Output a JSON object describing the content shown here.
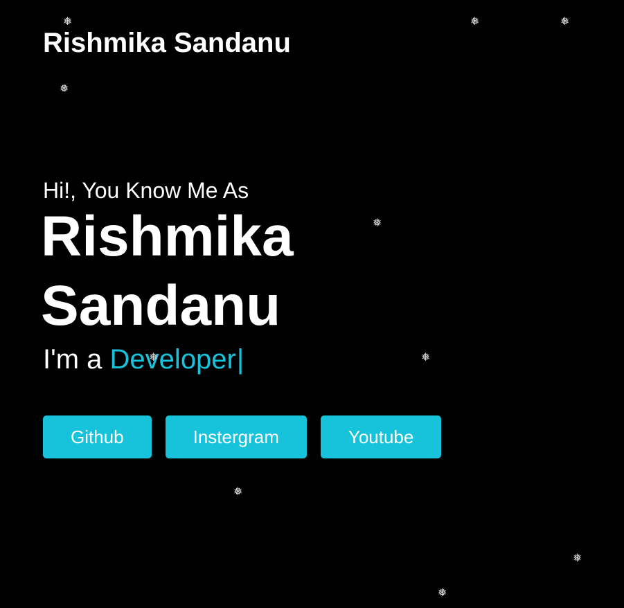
{
  "header": {
    "brand": "Rishmika Sandanu"
  },
  "hero": {
    "greeting": "Hi!, You Know Me As",
    "name": "Rishmika Sandanu",
    "tagline_prefix": "I'm a ",
    "tagline_role": "Developer",
    "caret": "|"
  },
  "buttons": {
    "github": "Github",
    "instagram": "Instergram",
    "youtube": "Youtube"
  },
  "decor": {
    "snowflake_glyph": "❅",
    "snowflake_icon": "snowflake-icon"
  },
  "colors": {
    "background": "#000000",
    "text": "#ffffff",
    "accent": "#16c3db"
  }
}
